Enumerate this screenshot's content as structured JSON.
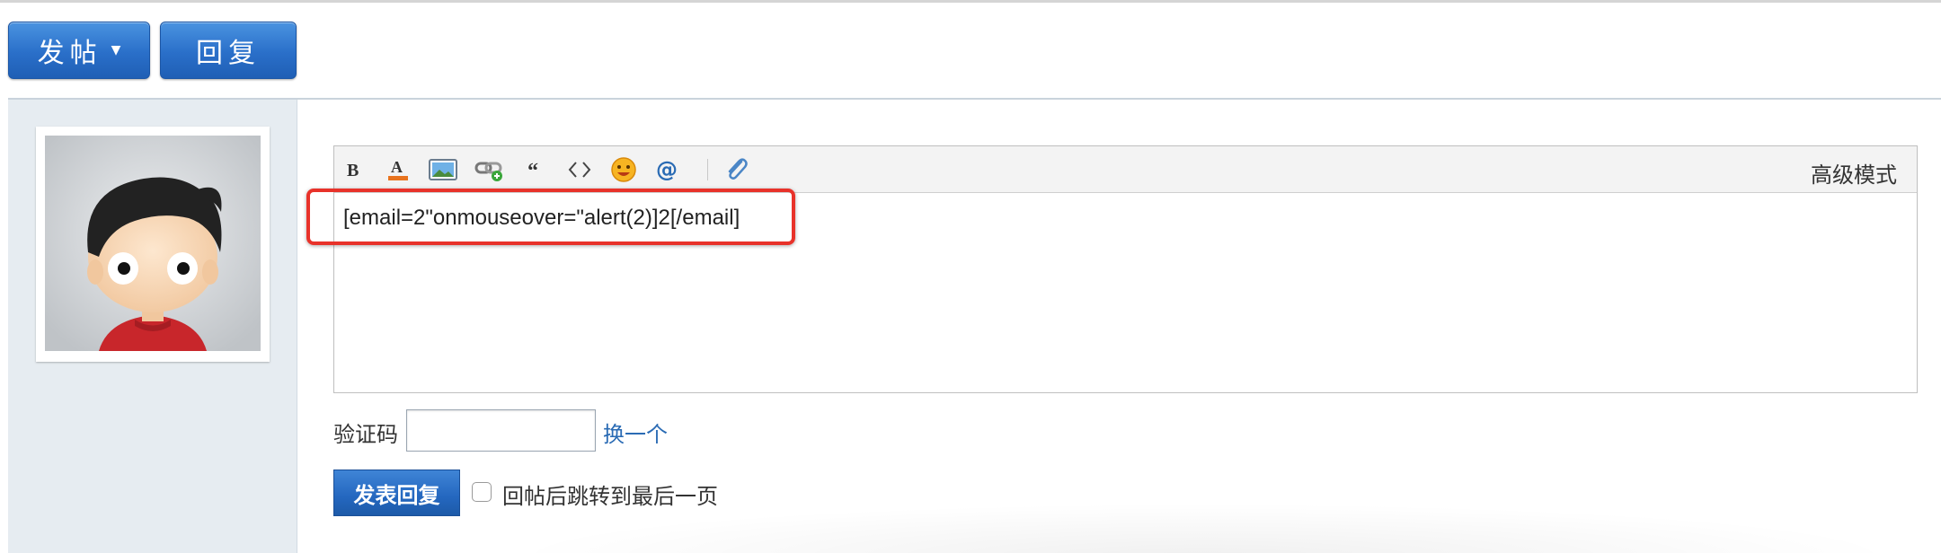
{
  "actions": {
    "post_label": "发帖",
    "reply_label": "回复"
  },
  "editor": {
    "toolbar": {
      "items": [
        "bold-icon",
        "font-color-icon",
        "image-icon",
        "link-icon",
        "quote-icon",
        "code-icon",
        "smiley-icon",
        "at-mention-icon",
        "attachment-icon"
      ],
      "advanced_mode_label": "高级模式"
    },
    "content": "[email=2\"onmouseover=\"alert(2)]2[/email]"
  },
  "captcha": {
    "label": "验证码",
    "value": "",
    "change_label": "换一个"
  },
  "submit": {
    "label": "发表回复",
    "jump_last_page_label": "回帖后跳转到最后一页",
    "jump_last_page_checked": false
  },
  "colors": {
    "primary_button": "#2a6fc9",
    "link": "#2a6bb4",
    "highlight_border": "#e8322a",
    "left_column_bg": "#e6ecf1"
  }
}
